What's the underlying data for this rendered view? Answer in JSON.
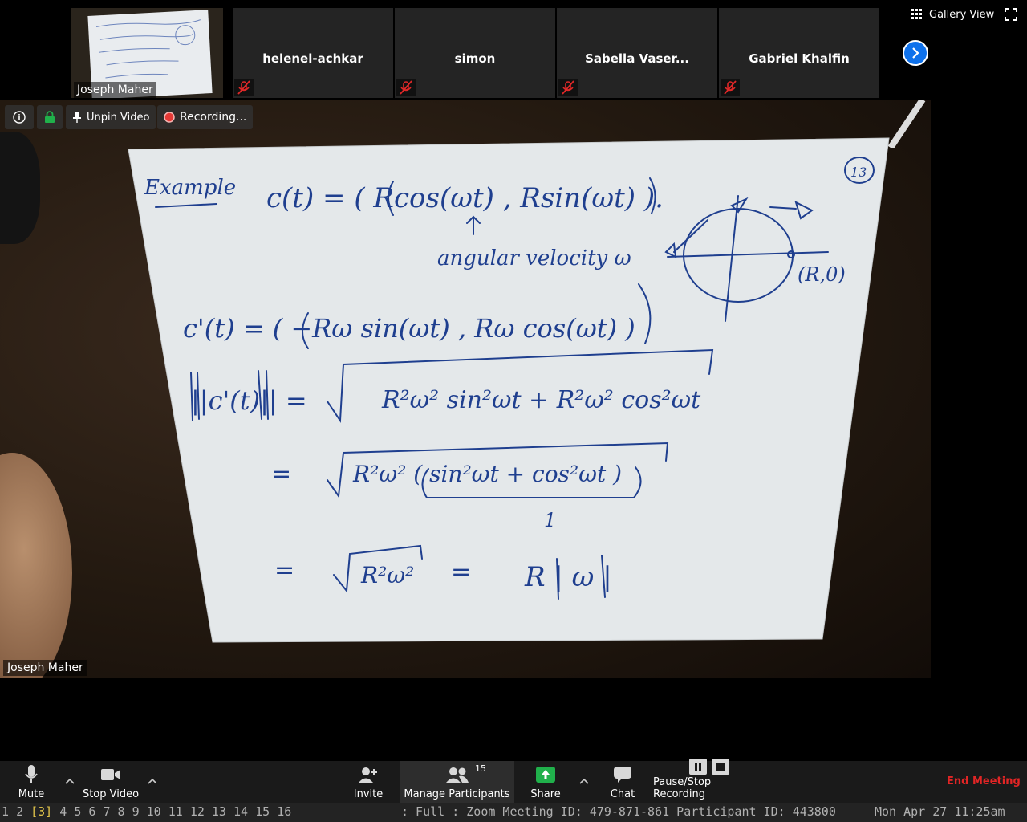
{
  "gallery": {
    "self_tile": {
      "name": "Joseph Maher"
    },
    "participants": [
      {
        "name": "helenel-achkar",
        "muted": true
      },
      {
        "name": "simon",
        "muted": true
      },
      {
        "name": "Sabella Vaser...",
        "muted": true
      },
      {
        "name": "Gabriel Khalfin",
        "muted": true
      }
    ],
    "view_label": "Gallery View"
  },
  "main_video": {
    "speaker_name": "Joseph Maher",
    "overlay": {
      "unpin_label": "Unpin Video",
      "recording_label": "Recording..."
    },
    "whiteboard": {
      "page_number": "13",
      "lines": {
        "example": "Example",
        "c_def": "c(t) = ( Rcos(ωt) , Rsin(ωt) ).",
        "angular_note": "angular velocity ω",
        "deriv": "c'(t) = ( −Rω sin(ωt) , Rω cos(ωt) )",
        "norm_lhs": "||c'(t)|| =",
        "norm_rhs": "R²ω² sin²ωt + R²ω² cos²ωt",
        "eq2": "R²ω² ( sin²ωt + cos²ωt )",
        "one": "1",
        "eq3": "R²ω²",
        "result": "R | ω |",
        "point_label": "(R,0)"
      }
    }
  },
  "toolbar": {
    "mute_label": "Mute",
    "stop_video_label": "Stop Video",
    "invite_label": "Invite",
    "manage_participants_label": "Manage Participants",
    "participant_count": "15",
    "share_label": "Share",
    "chat_label": "Chat",
    "recording_label": "Pause/Stop Recording",
    "end_meeting_label": "End Meeting"
  },
  "status_bar": {
    "workspaces": [
      "1",
      "2",
      "[3]",
      "4",
      "5",
      "6",
      "7",
      "8",
      "9",
      "10",
      "11",
      "12",
      "13",
      "14",
      "15",
      "16"
    ],
    "active_workspace": "[3]",
    "meeting_info": ": Full : Zoom Meeting ID: 479-871-861 Participant ID: 443800",
    "clock": "Mon Apr 27 11:25am"
  },
  "colors": {
    "accent_blue": "#0e71eb",
    "end_meeting_red": "#e22525",
    "mute_red": "#e02828",
    "recording_red": "#e53935",
    "share_green": "#20b04b",
    "ink_blue": "#1f3f8f"
  }
}
